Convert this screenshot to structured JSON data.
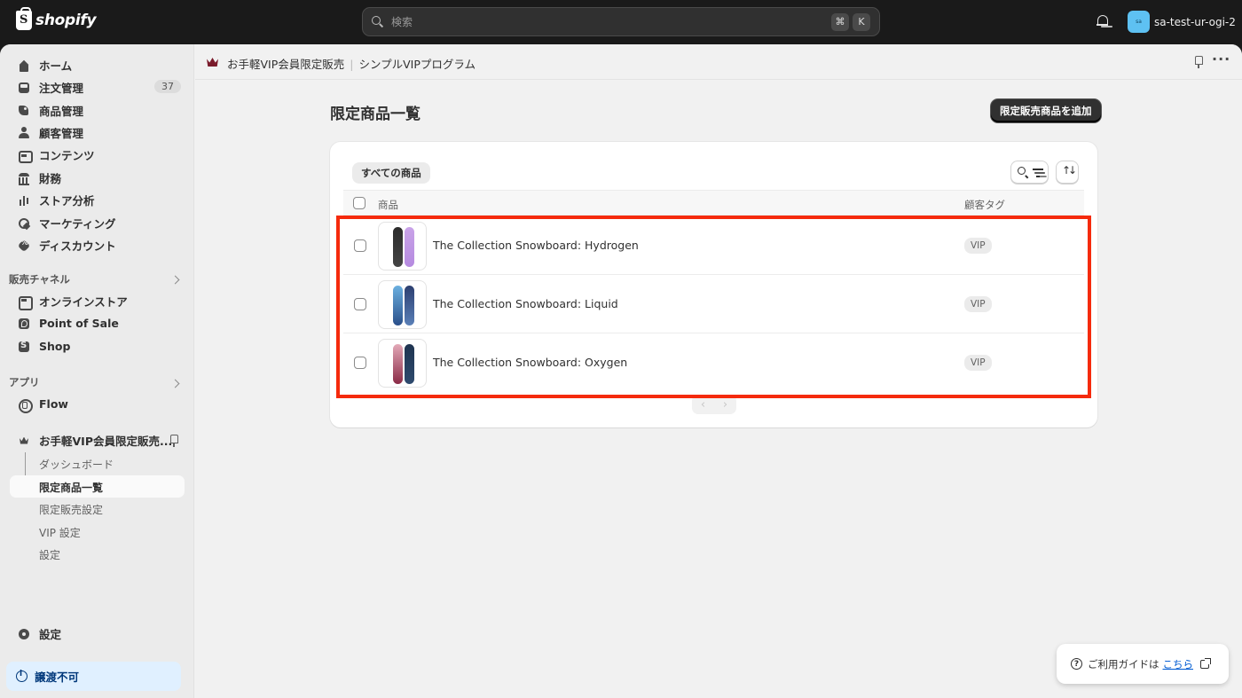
{
  "topbar": {
    "logo_text": "shopify",
    "logo_glyph": "S",
    "search_placeholder": "検索",
    "shortcut_keys": [
      "⌘",
      "K"
    ],
    "store_avatar": "sa",
    "store_name": "sa-test-ur-ogi-2"
  },
  "sidebar": {
    "items": [
      {
        "label": "ホーム",
        "icon": "home-icon"
      },
      {
        "label": "注文管理",
        "icon": "inbox-icon",
        "badge": "37"
      },
      {
        "label": "商品管理",
        "icon": "tag-icon"
      },
      {
        "label": "顧客管理",
        "icon": "person-icon"
      },
      {
        "label": "コンテンツ",
        "icon": "content-icon"
      },
      {
        "label": "財務",
        "icon": "bank-icon"
      },
      {
        "label": "ストア分析",
        "icon": "chart-icon"
      },
      {
        "label": "マーケティング",
        "icon": "target-icon"
      },
      {
        "label": "ディスカウント",
        "icon": "discount-icon"
      }
    ],
    "sales_channels_label": "販売チャネル",
    "channels": [
      {
        "label": "オンラインストア",
        "icon": "store-icon"
      },
      {
        "label": "Point of Sale",
        "icon": "pos-icon"
      },
      {
        "label": "Shop",
        "icon": "shop-icon"
      }
    ],
    "apps_label": "アプリ",
    "apps": [
      {
        "label": "Flow",
        "icon": "flow-icon"
      }
    ],
    "current_app": {
      "label": "お手軽VIP会員限定販売...",
      "sub_items": [
        "ダッシュボード",
        "限定商品一覧",
        "限定販売設定",
        "VIP 設定",
        "設定"
      ],
      "active_index": 1
    },
    "settings_label": "設定",
    "transfer_label": "譲渡不可"
  },
  "app_header": {
    "app_name": "お手軽VIP会員限定販売",
    "separator": "|",
    "program_name": "シンプルVIPプログラム",
    "more_label": "···"
  },
  "page": {
    "title": "限定商品一覧",
    "add_button_label": "限定販売商品を追加",
    "filter_tab_label": "すべての商品",
    "columns": {
      "product": "商品",
      "customer_tag": "顧客タグ"
    },
    "rows": [
      {
        "name": "The Collection Snowboard: Hydrogen",
        "tag": "VIP"
      },
      {
        "name": "The Collection Snowboard: Liquid",
        "tag": "VIP"
      },
      {
        "name": "The Collection Snowboard: Oxygen",
        "tag": "VIP"
      }
    ],
    "pager": {
      "prev": "‹",
      "next": "›"
    }
  },
  "guide": {
    "text": "ご利用ガイドは",
    "link_text": "こちら",
    "q_glyph": "?"
  },
  "colors": {
    "highlight": "#f52a0c",
    "topbar": "#1a1a1a",
    "primary_button": "#303030"
  }
}
